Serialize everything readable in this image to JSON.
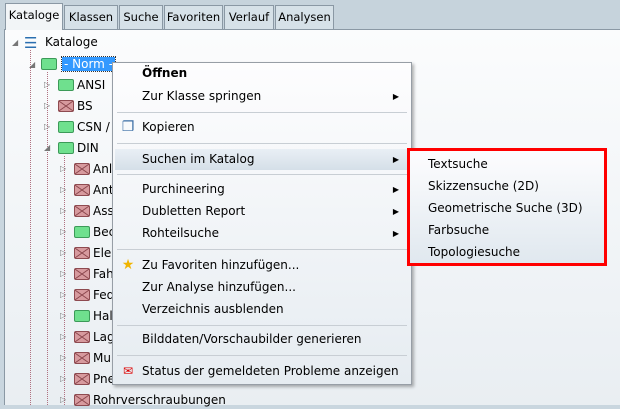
{
  "tabs": [
    "Kataloge",
    "Klassen",
    "Suche",
    "Favoriten",
    "Verlauf",
    "Analysen"
  ],
  "tree": {
    "root": "Kataloge",
    "selected": "- Norm -",
    "level2": [
      {
        "label": "ANSI",
        "color": "green"
      },
      {
        "label": "BS",
        "color": "red"
      },
      {
        "label": "CSN /",
        "color": "green"
      },
      {
        "label": "DIN",
        "color": "green"
      }
    ],
    "din_children": [
      {
        "label": "Anl",
        "color": "red"
      },
      {
        "label": "Ant",
        "color": "red"
      },
      {
        "label": "Ass",
        "color": "red"
      },
      {
        "label": "Bec",
        "color": "green"
      },
      {
        "label": "Elel",
        "color": "red"
      },
      {
        "label": "Fah",
        "color": "red"
      },
      {
        "label": "Fed",
        "color": "red"
      },
      {
        "label": "Hal",
        "color": "green"
      },
      {
        "label": "Lag",
        "color": "red"
      },
      {
        "label": "Mu",
        "color": "red"
      },
      {
        "label": "Pne",
        "color": "red"
      },
      {
        "label": "Rohrverschraubungen",
        "color": "red"
      }
    ]
  },
  "context_menu": {
    "open": "Öffnen",
    "goto_class": "Zur Klasse springen",
    "copy": "Kopieren",
    "search_catalog": "Suchen im Katalog",
    "purchineering": "Purchineering",
    "duplicates": "Dubletten Report",
    "raw_part": "Rohteilsuche",
    "add_favorites": "Zu Favoriten hinzufügen...",
    "add_analysis": "Zur Analyse hinzufügen...",
    "hide_dir": "Verzeichnis ausblenden",
    "gen_images": "Bilddaten/Vorschaubilder generieren",
    "status": "Status der gemeldeten Probleme anzeigen"
  },
  "submenu": [
    "Textsuche",
    "Skizzensuche (2D)",
    "Geometrische Suche (3D)",
    "Farbsuche",
    "Topologiesuche"
  ],
  "colors": {
    "selection": "#3399ff",
    "highlight_box": "#ff0000"
  }
}
